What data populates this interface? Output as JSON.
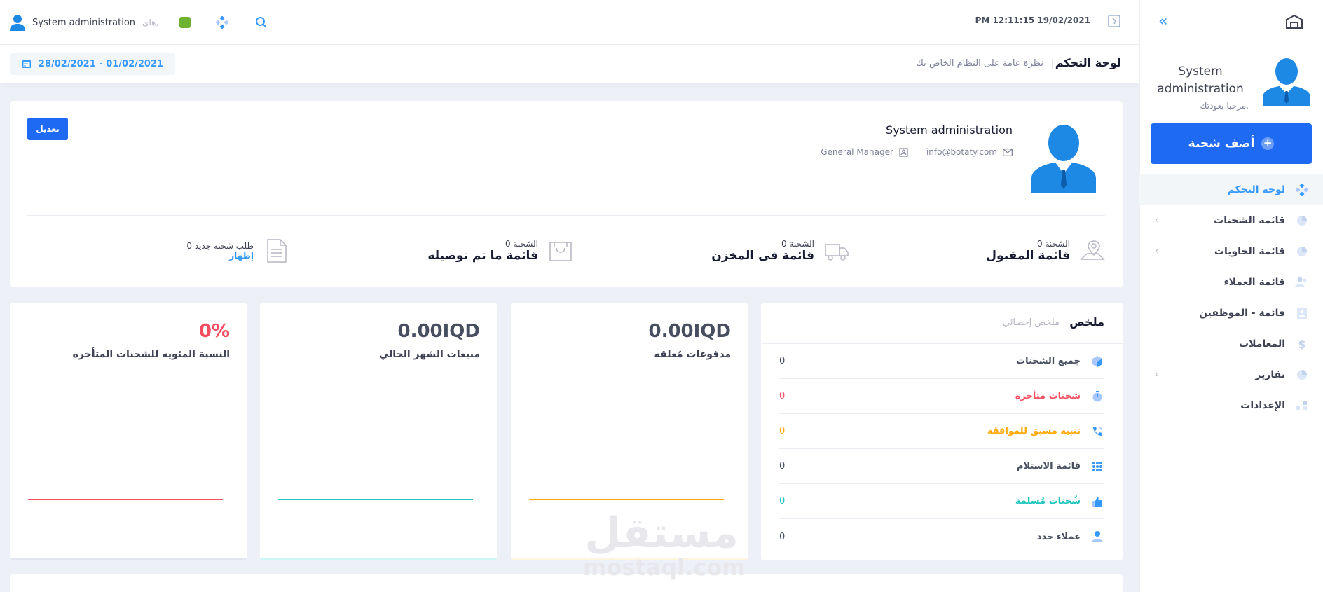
{
  "sidebar": {
    "user_name": "System administration",
    "welcome": "مرحبا بعودتك,",
    "add_button": "أضف شحنة",
    "items": [
      {
        "label": "لوحة التحكم",
        "icon": "dashboard-icon",
        "active": true,
        "arrow": ""
      },
      {
        "label": "قائمة الشحنات",
        "icon": "shipments-icon",
        "arrow": "‹"
      },
      {
        "label": "قائمة الحاويات",
        "icon": "containers-icon",
        "arrow": "‹"
      },
      {
        "label": "قائمة العملاء",
        "icon": "customers-icon",
        "arrow": ""
      },
      {
        "label": "قائمة - الموظفين",
        "icon": "employees-icon",
        "arrow": ""
      },
      {
        "label": "المعاملات",
        "icon": "dollar-icon",
        "arrow": ""
      },
      {
        "label": "تقارير",
        "icon": "reports-icon",
        "arrow": "‹"
      },
      {
        "label": "الإعدادات",
        "icon": "settings-icon",
        "arrow": ""
      }
    ]
  },
  "topbar": {
    "user_name": "System administration",
    "greeting": "هاي,",
    "datetime": "PM 12:11:15 19/02/2021"
  },
  "subheader": {
    "title": "لوحة التحكم",
    "subtitle": "نظرة عامة على النظام الخاص بك",
    "date_range": "28/02/2021 - 01/02/2021"
  },
  "profile": {
    "name": "System administration",
    "email": "info@botaty.com",
    "role": "General Manager",
    "edit_label": "تعديل",
    "stats": [
      {
        "count": "0 الشحنة",
        "label": "قائمة المقبول",
        "icon": "map-location-icon"
      },
      {
        "count": "0 الشحنة",
        "label": "قائمة فى المخزن",
        "icon": "truck-icon"
      },
      {
        "count": "0 الشحنة",
        "label": "قائمة ما تم توصيله",
        "icon": "shopping-bag-icon"
      },
      {
        "count": "0 طلب شحنه جديد",
        "link": "إظهار",
        "icon": "document-icon"
      }
    ]
  },
  "summary": {
    "title": "ملخص",
    "subtitle": "ملخص إحصائي",
    "rows": [
      {
        "label": "جميع الشحنات",
        "value": "0",
        "color": "#464e5f",
        "icon": "box-icon"
      },
      {
        "label": "شحنات متأخره",
        "value": "0",
        "color": "#f64e60",
        "icon": "stopwatch-icon"
      },
      {
        "label": "تنبيه مسبق للموافقة",
        "value": "0",
        "color": "#ffa800",
        "icon": "phone-icon"
      },
      {
        "label": "قائمة الاستلام",
        "value": "0",
        "color": "#464e5f",
        "icon": "grid-icon"
      },
      {
        "label": "شُحنات مُسلمة",
        "value": "0",
        "color": "#1bc5bd",
        "icon": "thumbs-up-icon"
      },
      {
        "label": "عملاء جدد",
        "value": "0",
        "color": "#464e5f",
        "icon": "user-icon"
      }
    ]
  },
  "mini_cards": [
    {
      "value": "0.00IQD",
      "label": "مدفوعات مُعلقه",
      "value_color": "#464e5f",
      "line_color": "#ffa800",
      "bottom_color": "#fff4de"
    },
    {
      "value": "0.00IQD",
      "label": "مبيعات الشهر الحالي",
      "value_color": "#464e5f",
      "line_color": "#1bc5bd",
      "bottom_color": "#c9f7f5"
    },
    {
      "value": "0%",
      "label": "النسبة المئويه للشحنات المتأخره",
      "value_color": "#f64e60",
      "line_color": "#f64e60",
      "bottom_color": "#e4e6ef"
    }
  ],
  "colors": {
    "primary": "#1e6af2",
    "accent": "#3699ff"
  },
  "watermark": {
    "arabic": "مستقل",
    "latin": "mostaql.com"
  }
}
